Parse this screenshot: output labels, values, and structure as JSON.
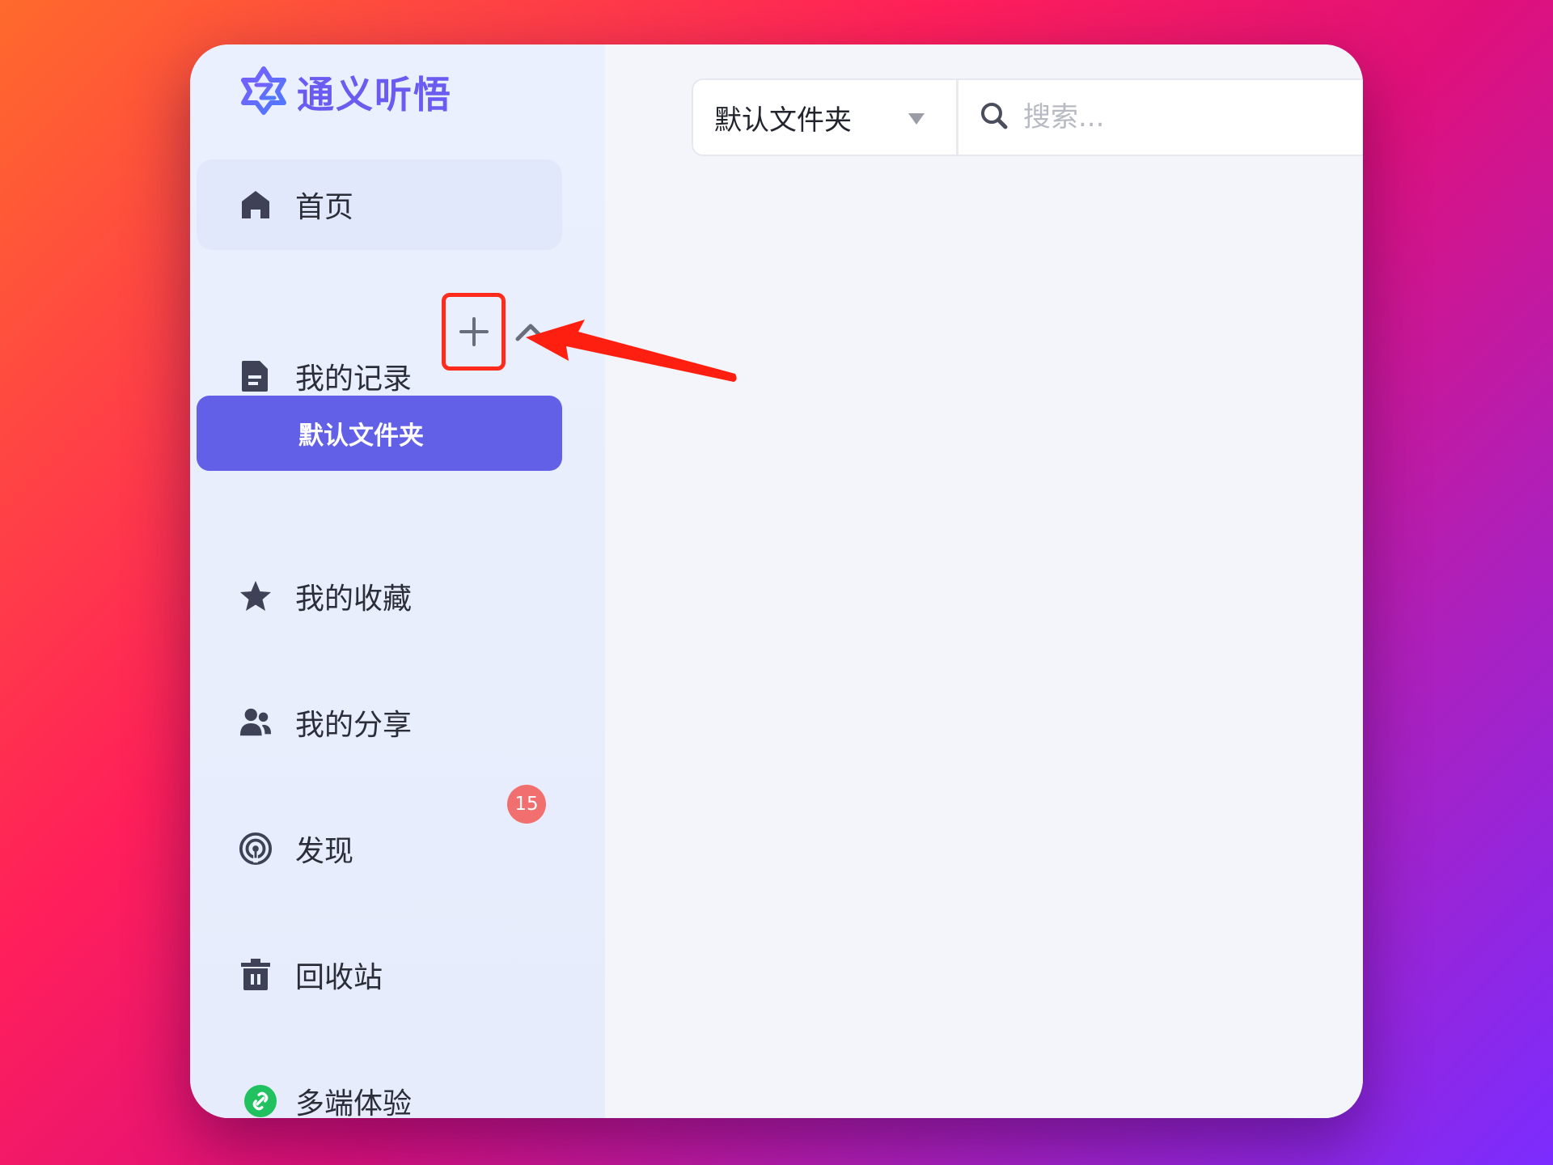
{
  "app": {
    "logo_text": "通义听悟",
    "brand_color": "#6a5cf0"
  },
  "sidebar": {
    "items": [
      {
        "label": "首页",
        "icon": "home-icon"
      },
      {
        "label": "我的记录",
        "icon": "document-icon"
      },
      {
        "label": "我的收藏",
        "icon": "star-icon"
      },
      {
        "label": "我的分享",
        "icon": "users-icon"
      },
      {
        "label": "发现",
        "icon": "broadcast-icon",
        "badge": "15"
      },
      {
        "label": "回收站",
        "icon": "trash-icon"
      },
      {
        "label": "多端体验",
        "icon": "link-icon"
      }
    ],
    "folders": [
      {
        "label": "默认文件夹",
        "selected": true
      }
    ],
    "selected_color": "#6160e6"
  },
  "toolbar": {
    "folder_select_value": "默认文件夹",
    "search_placeholder": "搜索..."
  },
  "annotation": {
    "highlight_color": "#ff2b1c"
  }
}
